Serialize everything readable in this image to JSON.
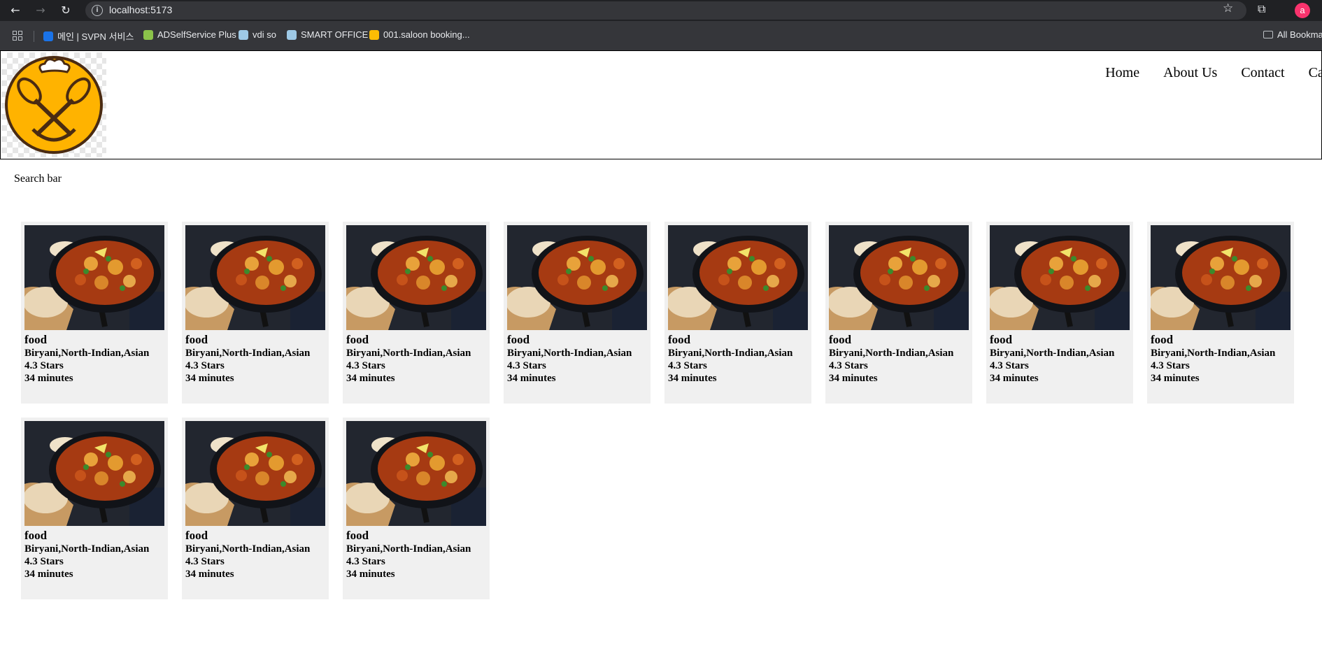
{
  "browser": {
    "url": "localhost:5173",
    "profile_initial": "a",
    "bookmarks": [
      {
        "label": "메인 | SVPN 서비스",
        "icon": "svpn-icon",
        "color": "#1a73e8"
      },
      {
        "label": "ADSelfService Plus",
        "icon": "adselfservice-icon",
        "color": "#8bc34a"
      },
      {
        "label": "vdi so",
        "icon": "vdi-icon",
        "color": "#9ec9e6"
      },
      {
        "label": "SMART OFFICE",
        "icon": "smart-office-icon",
        "color": "#9ec9e6"
      },
      {
        "label": "001.saloon booking...",
        "icon": "google-drive-icon",
        "color": "#fbbc04"
      }
    ],
    "all_bookmarks": "All Bookma"
  },
  "header": {
    "nav": [
      "Home",
      "About Us",
      "Contact",
      "Cart"
    ]
  },
  "search": {
    "label": "Search bar"
  },
  "cards": [
    {
      "title": "food",
      "cuisine": "Biryani,North-Indian,Asian",
      "rating": "4.3 Stars",
      "time": "34 minutes"
    },
    {
      "title": "food",
      "cuisine": "Biryani,North-Indian,Asian",
      "rating": "4.3 Stars",
      "time": "34 minutes"
    },
    {
      "title": "food",
      "cuisine": "Biryani,North-Indian,Asian",
      "rating": "4.3 Stars",
      "time": "34 minutes"
    },
    {
      "title": "food",
      "cuisine": "Biryani,North-Indian,Asian",
      "rating": "4.3 Stars",
      "time": "34 minutes"
    },
    {
      "title": "food",
      "cuisine": "Biryani,North-Indian,Asian",
      "rating": "4.3 Stars",
      "time": "34 minutes"
    },
    {
      "title": "food",
      "cuisine": "Biryani,North-Indian,Asian",
      "rating": "4.3 Stars",
      "time": "34 minutes"
    },
    {
      "title": "food",
      "cuisine": "Biryani,North-Indian,Asian",
      "rating": "4.3 Stars",
      "time": "34 minutes"
    },
    {
      "title": "food",
      "cuisine": "Biryani,North-Indian,Asian",
      "rating": "4.3 Stars",
      "time": "34 minutes"
    },
    {
      "title": "food",
      "cuisine": "Biryani,North-Indian,Asian",
      "rating": "4.3 Stars",
      "time": "34 minutes"
    },
    {
      "title": "food",
      "cuisine": "Biryani,North-Indian,Asian",
      "rating": "4.3 Stars",
      "time": "34 minutes"
    },
    {
      "title": "food",
      "cuisine": "Biryani,North-Indian,Asian",
      "rating": "4.3 Stars",
      "time": "34 minutes"
    }
  ],
  "colors": {
    "logo_yellow": "#ffb300",
    "logo_brown": "#4a2b12",
    "card_bg": "#f0f0f0"
  }
}
